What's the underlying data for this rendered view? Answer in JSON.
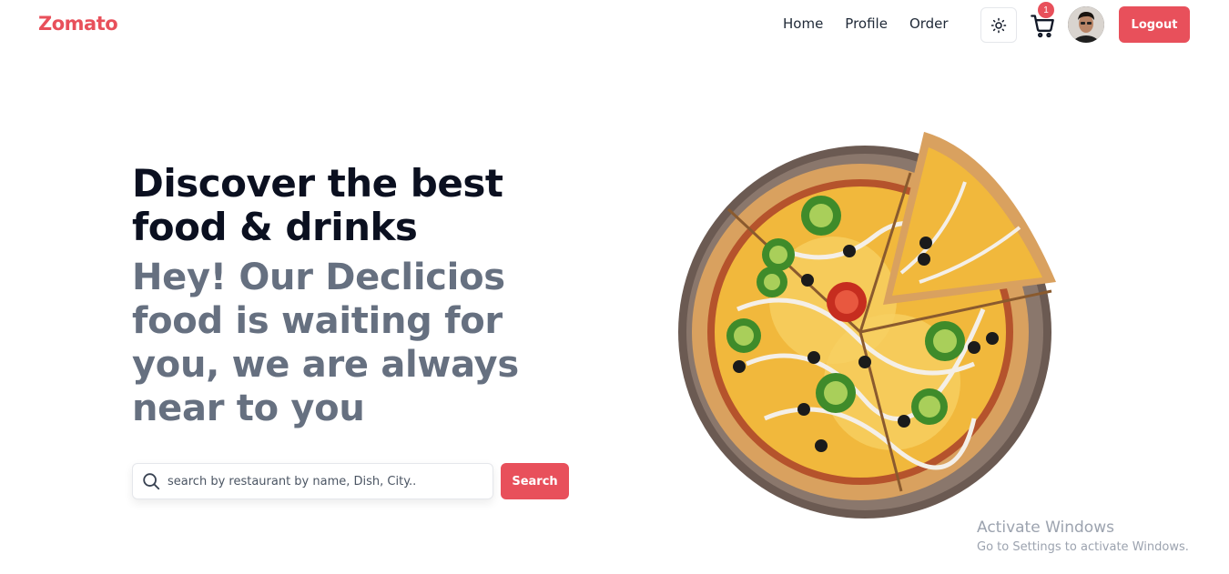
{
  "brand": {
    "name": "Zomato",
    "color": "#e8505b"
  },
  "nav": {
    "items": [
      "Home",
      "Profile",
      "Order"
    ]
  },
  "header": {
    "theme_icon": "sun-icon",
    "cart_icon": "cart-icon",
    "cart_count": "1",
    "logout_label": "Logout"
  },
  "hero": {
    "title": "Discover the best food & drinks",
    "subtitle": "Hey! Our Declicios food is waiting for you, we are always near to you"
  },
  "search": {
    "placeholder": "search by restaurant by name, Dish, City..",
    "button_label": "Search"
  },
  "watermark": {
    "line1": "Activate Windows",
    "line2": "Go to Settings to activate Windows."
  }
}
